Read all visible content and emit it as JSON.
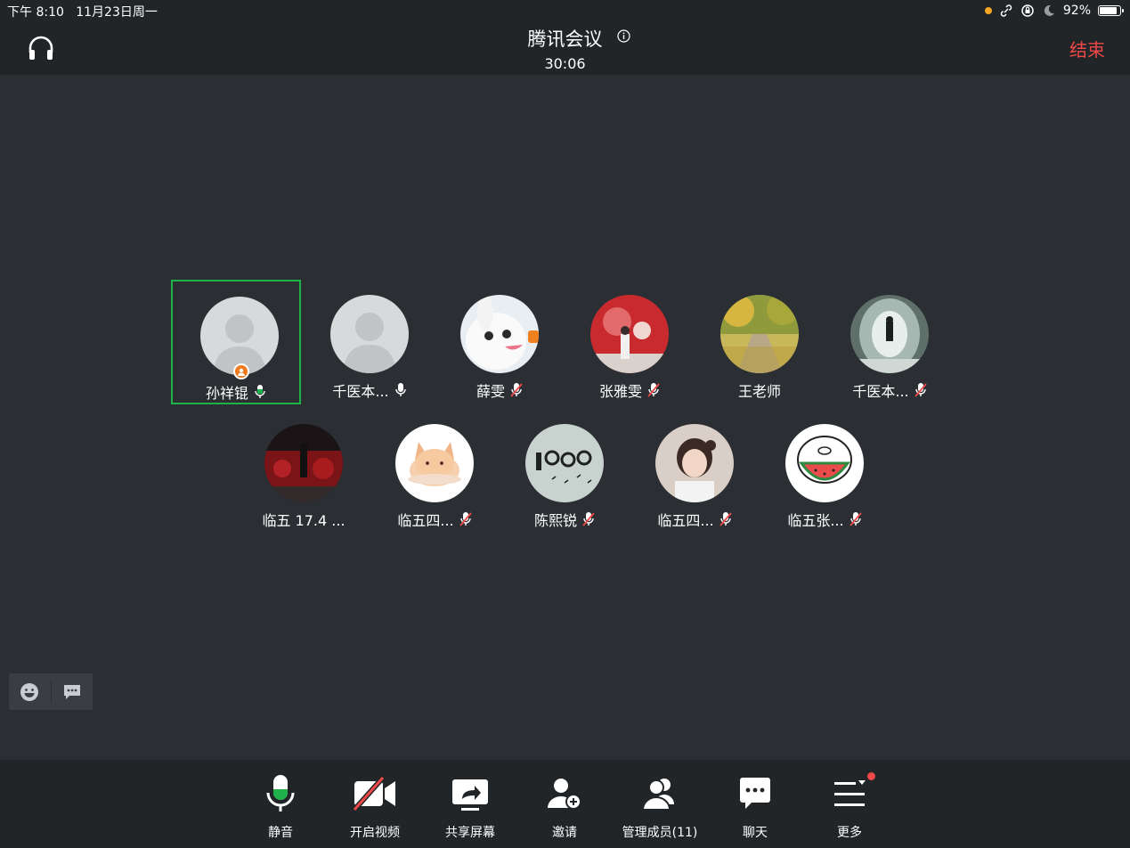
{
  "status_bar": {
    "time_date": "下午 8:10   11月23日周一",
    "battery": "92%",
    "battery_level": 0.92
  },
  "header": {
    "title": "腾讯会议",
    "timer": "30:06",
    "end_label": "结束"
  },
  "participants": [
    {
      "name": "孙祥锟",
      "mic": "active",
      "host": true
    },
    {
      "name": "千医本...",
      "mic": "on"
    },
    {
      "name": "薛雯",
      "mic": "muted"
    },
    {
      "name": "张雅雯",
      "mic": "muted"
    },
    {
      "name": "王老师",
      "mic": "none"
    },
    {
      "name": "千医本...",
      "mic": "muted"
    },
    {
      "name": "临五 17.4 ...",
      "mic": "none"
    },
    {
      "name": "临五四...",
      "mic": "muted"
    },
    {
      "name": "陈熙锐",
      "mic": "muted"
    },
    {
      "name": "临五四...",
      "mic": "muted"
    },
    {
      "name": "临五张...",
      "mic": "muted"
    }
  ],
  "toolbar": {
    "mute": "静音",
    "video": "开启视频",
    "share": "共享屏幕",
    "invite": "邀请",
    "members": "管理成员(11)",
    "chat": "聊天",
    "more": "更多"
  },
  "colors": {
    "background": "#2b2f33",
    "bar": "#222528",
    "accent_green": "#1fb14a",
    "end_red": "#ef4848",
    "muted_red": "#ef4848"
  }
}
